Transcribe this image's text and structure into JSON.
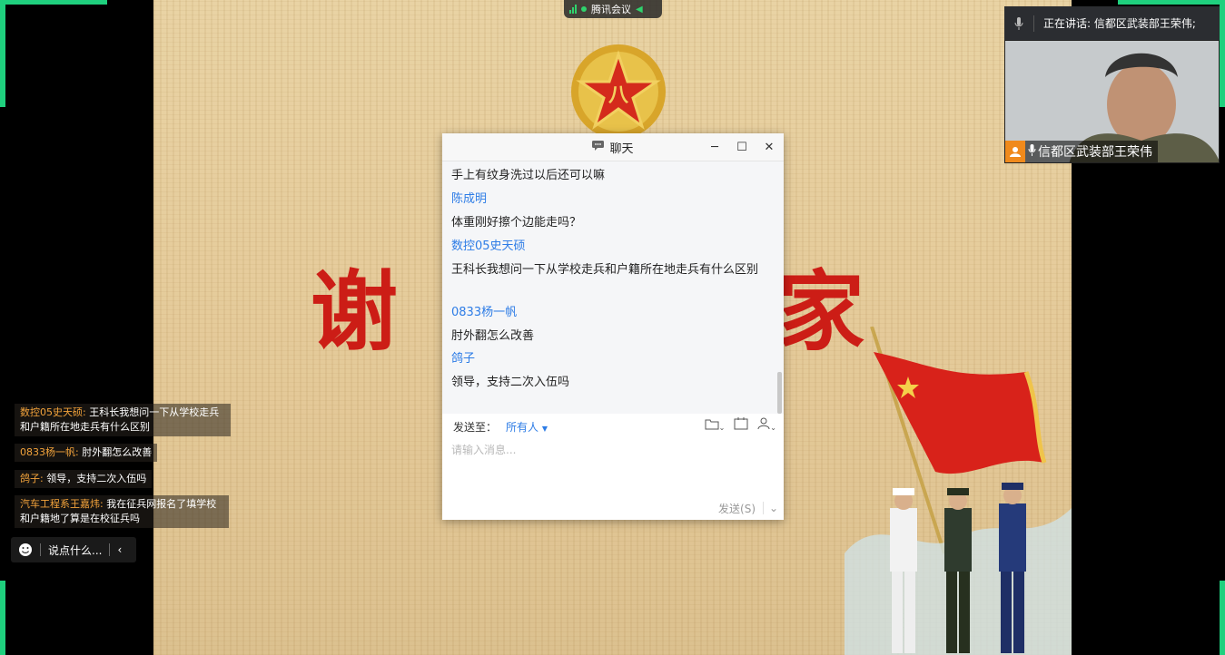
{
  "meeting": {
    "app_name": "腾讯会议"
  },
  "speaker": {
    "header_text": "正在讲话: 信都区武装部王荣伟;",
    "name": "信都区武装部王荣伟"
  },
  "slide": {
    "char_left": "谢",
    "char_right": "家"
  },
  "chat": {
    "title": "聊天",
    "messages": [
      {
        "type": "text",
        "text": "手上有纹身洗过以后还可以嘛"
      },
      {
        "type": "name",
        "text": "陈成明"
      },
      {
        "type": "text",
        "text": "体重刚好擦个边能走吗？"
      },
      {
        "type": "name",
        "text": "数控05史天硕"
      },
      {
        "type": "text",
        "text": "王科长我想问一下从学校走兵和户籍所在地走兵有什么区别"
      },
      {
        "type": "name",
        "text": "0833杨一帆"
      },
      {
        "type": "text",
        "text": "肘外翻怎么改善"
      },
      {
        "type": "name",
        "text": "鸽子"
      },
      {
        "type": "text",
        "text": "领导，支持二次入伍吗"
      }
    ],
    "send_to_label": "发送至：",
    "send_to_value": "所有人",
    "input_placeholder": "请输入消息...",
    "send_label": "发送(S)"
  },
  "bullets": [
    {
      "who": "数控05史天硕:",
      "text": " 王科长我想问一下从学校走兵和户籍所在地走兵有什么区别"
    },
    {
      "who": "0833杨一帆:",
      "text": " 肘外翻怎么改善"
    },
    {
      "who": "鸽子:",
      "text": " 领导，支持二次入伍吗"
    },
    {
      "who": "汽车工程系王嘉炜:",
      "text": " 我在征兵网报名了填学校和户籍地了算是在校征兵吗"
    }
  ],
  "say_bar": {
    "placeholder": "说点什么..."
  },
  "colors": {
    "accent": "#2d7ce6",
    "frame_green": "#1fd07e",
    "slide_red": "#cc1d16"
  }
}
